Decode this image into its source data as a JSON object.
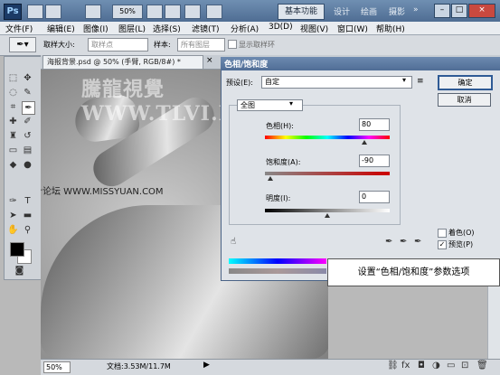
{
  "titlebar": {
    "app_logo": "Ps",
    "zoom_select": "50%",
    "workspace_button": "基本功能",
    "workspaces": [
      "设计",
      "绘画",
      "摄影"
    ],
    "window_buttons": [
      "–",
      "□",
      "×"
    ]
  },
  "menu": [
    "文件(F)",
    "编辑(E)",
    "图像(I)",
    "图层(L)",
    "选择(S)",
    "滤镜(T)",
    "分析(A)",
    "3D(D)",
    "视图(V)",
    "窗口(W)",
    "帮助(H)"
  ],
  "options": {
    "sample_size_label": "取样大小:",
    "sample_size_value": "取样点",
    "sample_label": "样本:",
    "sample_value": "所有图层",
    "show_ring_label": "显示取样环"
  },
  "document": {
    "tab_title": "海报背景.psd @ 50% (手臂, RGB/8#) *",
    "watermark_top": "騰龍視覺 WWW.TLVI.NET",
    "watermark_mid": "思缘设计论坛 WWW.MISSYUAN.COM",
    "zoom": "50%",
    "doc_info": "文档:3.53M/11.7M"
  },
  "dialog": {
    "title": "色相/饱和度",
    "preset_label": "预设(E):",
    "preset_value": "自定",
    "channel_value": "全图",
    "ok_label": "确定",
    "cancel_label": "取消",
    "hue_label": "色相(H):",
    "hue_value": "80",
    "saturation_label": "饱和度(A):",
    "saturation_value": "-90",
    "lightness_label": "明度(I):",
    "lightness_value": "0",
    "colorize_label": "着色(O)",
    "preview_label": "预览(P)",
    "colorize_checked": false,
    "preview_checked": true,
    "hue_level": 0.61,
    "saturation_level": 0.05,
    "lightness_level": 0.5
  },
  "callout": "设置“色相/饱和度”参数选项",
  "colors": {
    "title_blue": "#4f6d93",
    "dialog_bg": "#dfe3e8"
  }
}
